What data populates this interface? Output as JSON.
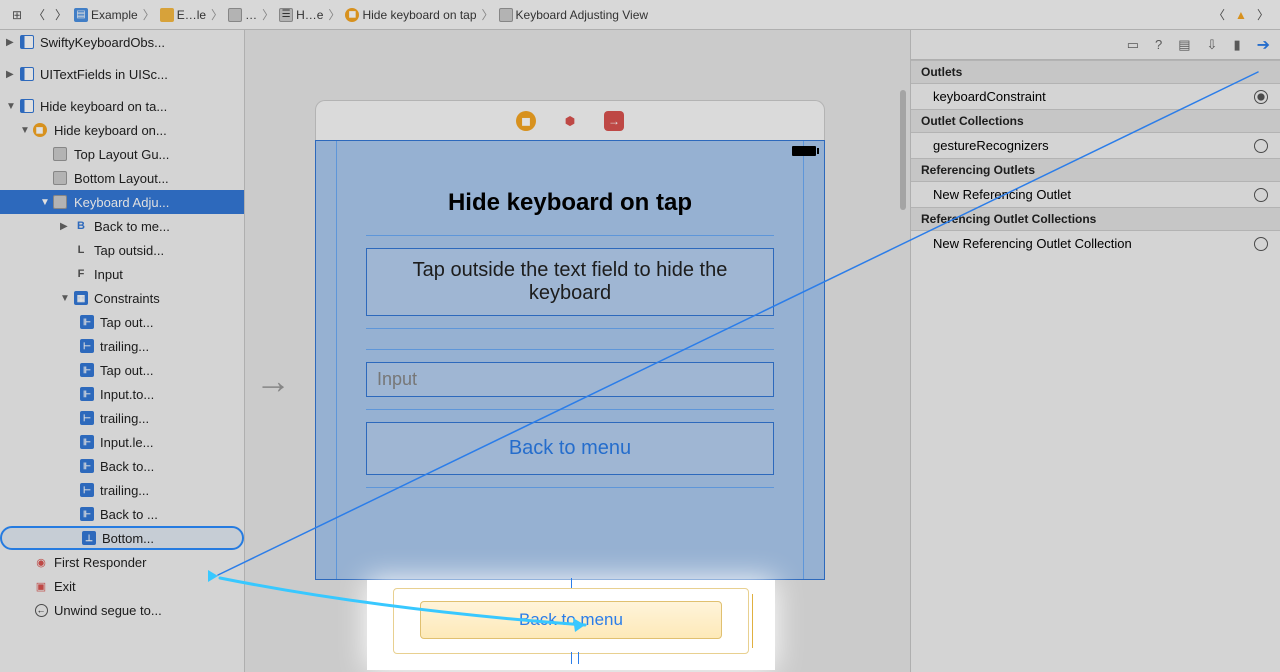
{
  "breadcrumb": {
    "proj": "Example",
    "folder": "E…le",
    "ellipsis": "…",
    "storyboard": "H…e",
    "scene": "Hide keyboard on tap",
    "view": "Keyboard Adjusting View"
  },
  "tree": {
    "group1": "SwiftyKeyboardObs...",
    "group2": "UITextFields in UISc...",
    "group3": "Hide keyboard on ta...",
    "scene": "Hide keyboard on...",
    "topLayout": "Top Layout Gu...",
    "bottomLayout": "Bottom Layout...",
    "kav": "Keyboard Adju...",
    "backBtn": "Back to me...",
    "tapLabel": "Tap outsid...",
    "input": "Input",
    "constraints": "Constraints",
    "c1": "Tap out...",
    "c2": "trailing...",
    "c3": "Tap out...",
    "c4": "Input.to...",
    "c5": "trailing...",
    "c6": "Input.le...",
    "c7": "Back to...",
    "c8": "trailing...",
    "c9": "Back to ...",
    "c10": "Bottom...",
    "firstResponder": "First Responder",
    "exit": "Exit",
    "unwind": "Unwind segue to..."
  },
  "canvas": {
    "title": "Hide keyboard on tap",
    "label": "Tap outside the text field to hide the keyboard",
    "placeholder": "Input",
    "button": "Back to menu",
    "spotButton": "Back to menu"
  },
  "inspector": {
    "sec1": "Outlets",
    "row1": "keyboardConstraint",
    "sec2": "Outlet Collections",
    "row2": "gestureRecognizers",
    "sec3": "Referencing Outlets",
    "row3": "New Referencing Outlet",
    "sec4": "Referencing Outlet Collections",
    "row4": "New Referencing Outlet Collection"
  },
  "badges": {
    "B": "B",
    "L": "L",
    "F": "F"
  }
}
